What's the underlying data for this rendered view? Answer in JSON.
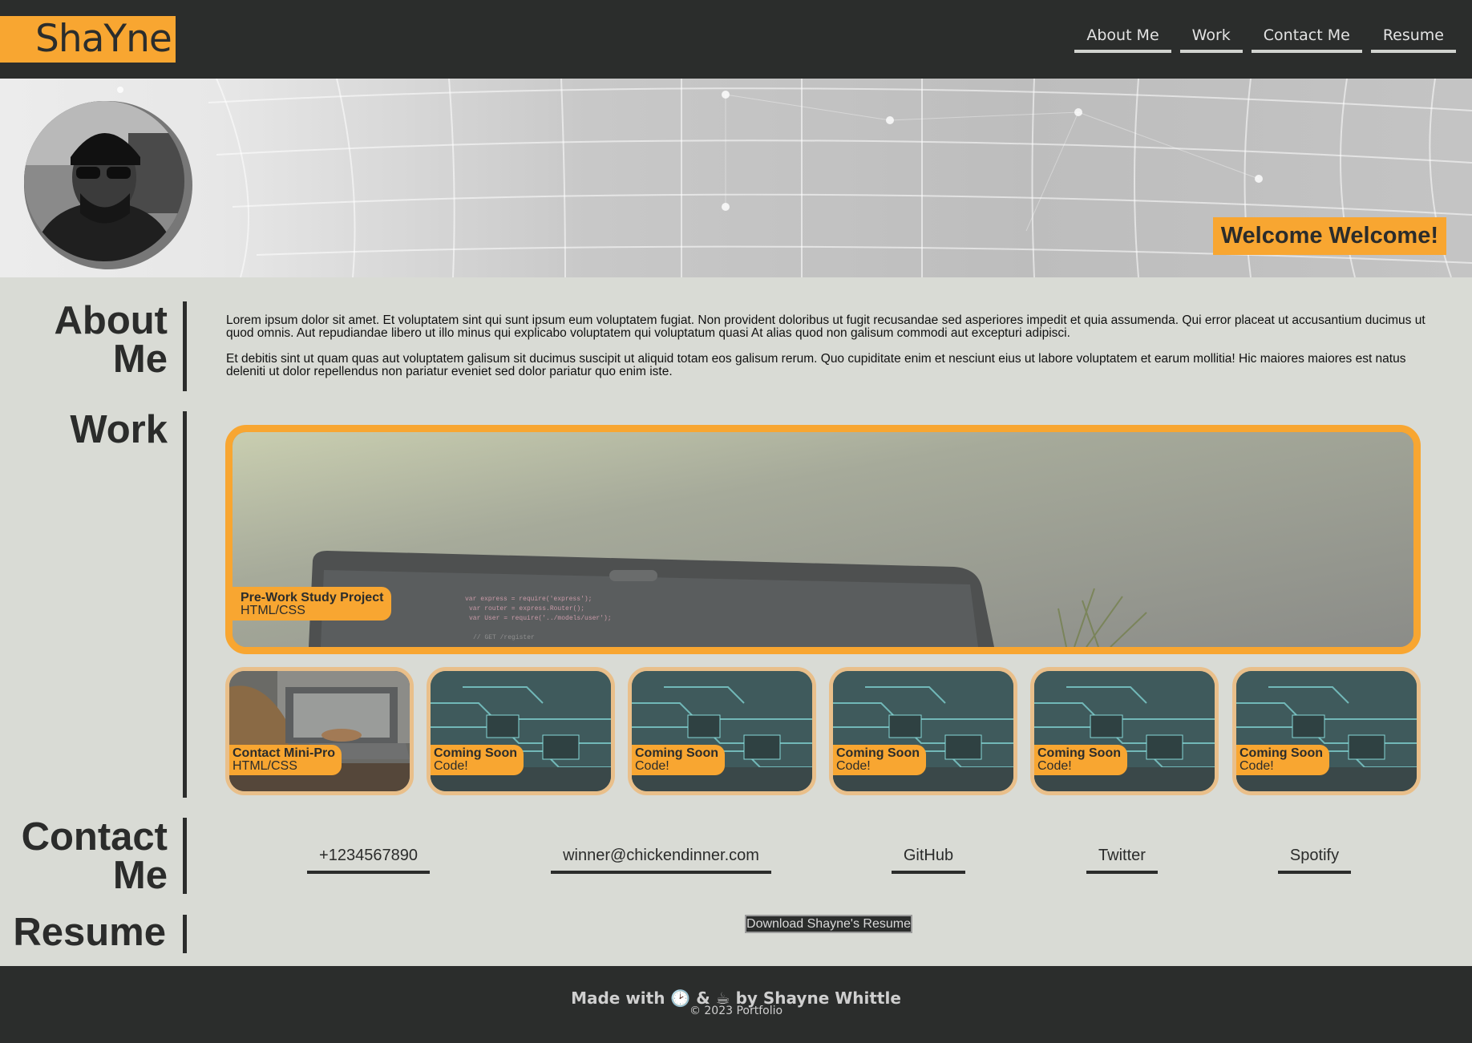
{
  "header": {
    "logo": "ShaYne",
    "nav": [
      "About Me",
      "Work",
      "Contact Me",
      "Resume"
    ]
  },
  "hero": {
    "welcome": "Welcome Welcome!"
  },
  "about": {
    "title_line1": "About",
    "title_line2": "Me",
    "paragraphs": [
      "Lorem ipsum dolor sit amet. Et voluptatem sint qui sunt ipsum eum voluptatem fugiat. Non provident doloribus ut fugit recusandae sed asperiores impedit et quia assumenda. Qui error placeat ut accusantium ducimus ut quod omnis. Aut repudiandae libero ut illo minus qui explicabo voluptatem qui voluptatum quasi At alias quod non galisum commodi aut excepturi adipisci.",
      "Et debitis sint ut quam quas aut voluptatem galisum sit ducimus suscipit ut aliquid totam eos galisum rerum. Quo cupiditate enim et nesciunt eius ut labore voluptatem et earum mollitia! Hic maiores maiores est natus deleniti ut dolor repellendus non pariatur eveniet sed dolor pariatur quo enim iste."
    ]
  },
  "work": {
    "title": "Work",
    "featured": {
      "title": "Pre-Work Study Project",
      "subtitle": "HTML/CSS"
    },
    "cards": [
      {
        "title": "Contact Mini-Pro",
        "subtitle": "HTML/CSS"
      },
      {
        "title": "Coming Soon",
        "subtitle": "Code!"
      },
      {
        "title": "Coming Soon",
        "subtitle": "Code!"
      },
      {
        "title": "Coming Soon",
        "subtitle": "Code!"
      },
      {
        "title": "Coming Soon",
        "subtitle": "Code!"
      },
      {
        "title": "Coming Soon",
        "subtitle": "Code!"
      }
    ]
  },
  "contact": {
    "title_line1": "Contact",
    "title_line2": "Me",
    "links": [
      "+1234567890",
      "winner@chickendinner.com",
      "GitHub",
      "Twitter",
      "Spotify"
    ]
  },
  "resume": {
    "title": "Resume",
    "button": "Download Shayne's Resume"
  },
  "footer": {
    "made": "Made with 🕑 & ☕ by Shayne Whittle",
    "copy": "© 2023 Portfolio"
  },
  "colors": {
    "accent": "#f8a631",
    "dark": "#2b2d2c",
    "background": "#d9dbd5"
  }
}
